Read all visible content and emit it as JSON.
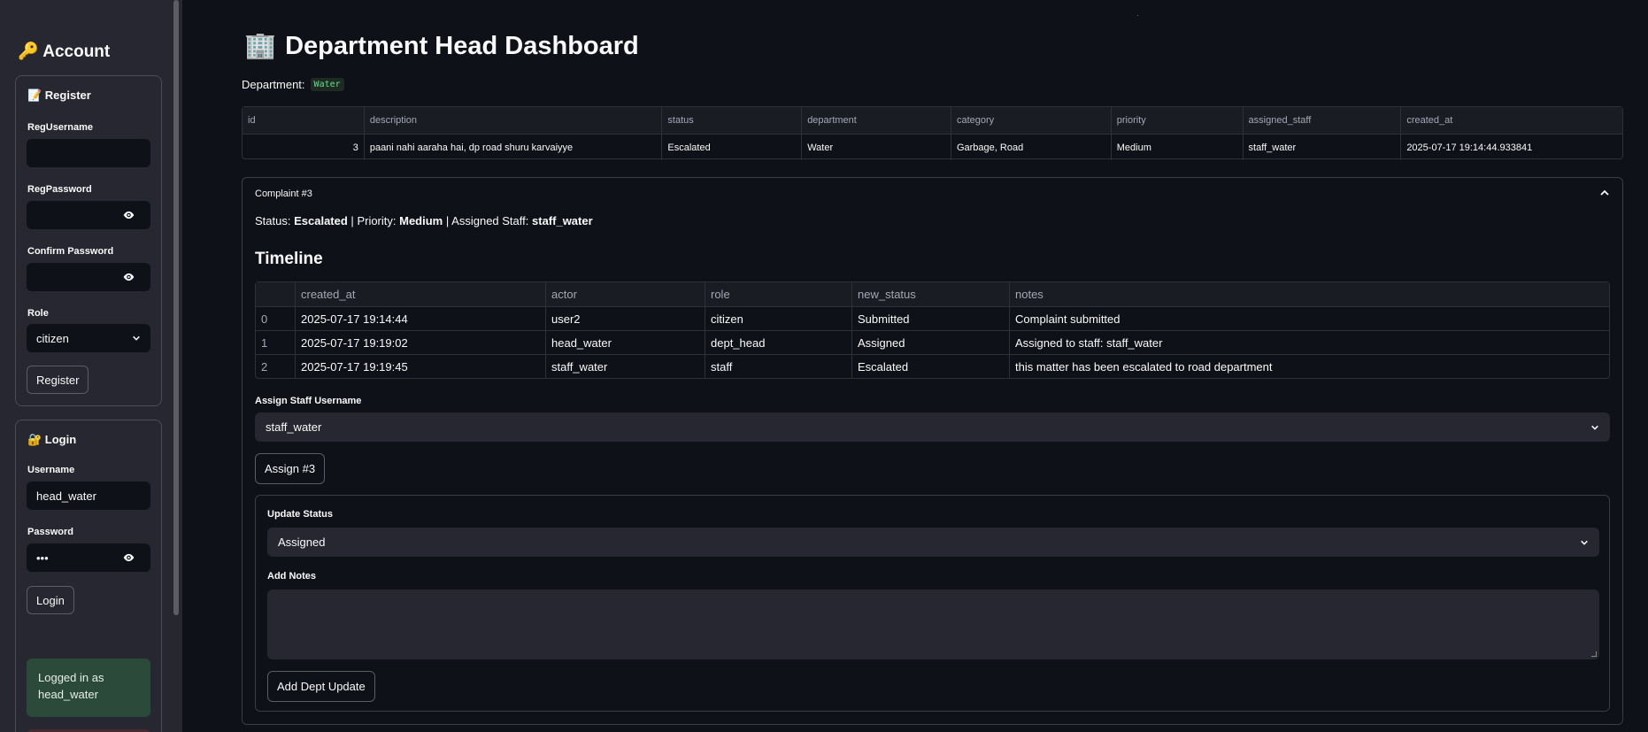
{
  "sidebar": {
    "title": "🔑 Account",
    "register": {
      "heading": "📝 Register",
      "username_label": "RegUsername",
      "username_value": "",
      "password_label": "RegPassword",
      "password_value": "",
      "confirm_label": "Confirm Password",
      "confirm_value": "",
      "role_label": "Role",
      "role_value": "citizen",
      "button": "Register"
    },
    "login": {
      "heading": "🔐 Login",
      "username_label": "Username",
      "username_value": "head_water",
      "password_label": "Password",
      "password_value": "•••",
      "button": "Login"
    },
    "logged_in_text": "Logged in as head_water"
  },
  "main": {
    "title_icon": "🏢",
    "title": "Department Head Dashboard",
    "dept_label": "Department:",
    "dept_value": "Water",
    "complaints_table": {
      "columns": [
        "id",
        "description",
        "status",
        "department",
        "category",
        "priority",
        "assigned_staff",
        "created_at"
      ],
      "rows": [
        [
          "3",
          "paani nahi aaraha hai, dp road shuru karvaiyye",
          "Escalated",
          "Water",
          "Garbage, Road",
          "Medium",
          "staff_water",
          "2025-07-17 19:14:44.933841"
        ]
      ]
    },
    "expander": {
      "title": "Complaint #3",
      "status_label": "Status:",
      "status_value": "Escalated",
      "priority_label": "Priority:",
      "priority_value": "Medium",
      "assigned_label": "Assigned Staff:",
      "assigned_value": "staff_water",
      "sep": "|",
      "timeline_heading": "Timeline",
      "timeline": {
        "columns": [
          "",
          "created_at",
          "actor",
          "role",
          "new_status",
          "notes"
        ],
        "rows": [
          [
            "0",
            "2025-07-17 19:14:44",
            "user2",
            "citizen",
            "Submitted",
            "Complaint submitted"
          ],
          [
            "1",
            "2025-07-17 19:19:02",
            "head_water",
            "dept_head",
            "Assigned",
            "Assigned to staff: staff_water"
          ],
          [
            "2",
            "2025-07-17 19:19:45",
            "staff_water",
            "staff",
            "Escalated",
            "this matter has been escalated to road department"
          ]
        ]
      },
      "assign_label": "Assign Staff Username",
      "assign_value": "staff_water",
      "assign_button": "Assign #3",
      "update_status_label": "Update Status",
      "update_status_value": "Assigned",
      "notes_label": "Add Notes",
      "notes_value": "",
      "update_button": "Add Dept Update"
    }
  },
  "colors": {
    "background": "#0e1117",
    "sidebar": "#262730",
    "success_bg": "#2b4a3a",
    "code_text": "#5ce488"
  }
}
